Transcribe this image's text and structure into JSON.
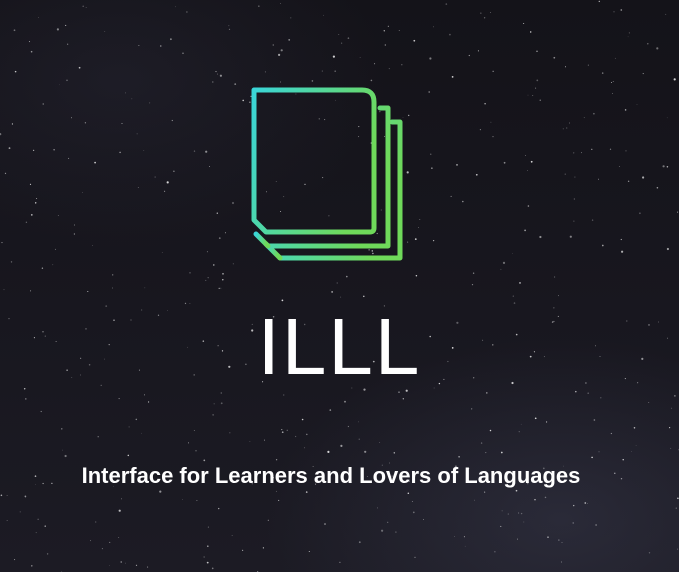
{
  "brand": {
    "logo_icon": "stacked-pages-icon",
    "name": "ILLL",
    "tagline": "Interface for Learners and Lovers of Languages"
  },
  "colors": {
    "background": "#15141c",
    "logo_gradient_start": "#3ad6d8",
    "logo_gradient_end": "#6fd95a",
    "text": "#ffffff"
  }
}
